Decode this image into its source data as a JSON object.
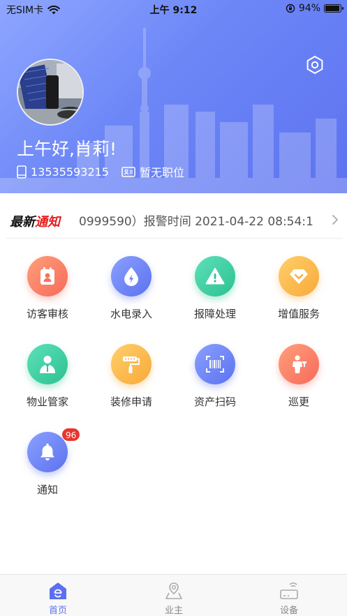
{
  "status_bar": {
    "carrier": "无SIM卡",
    "time": "上午 9:12",
    "battery": "94%",
    "battery_level": 0.94
  },
  "profile": {
    "greeting": "上午好,肖莉!",
    "phone": "13535593215",
    "position": "暂无职位"
  },
  "notice": {
    "title_black": "最新",
    "title_red": "通知",
    "text": "0999590）报警时间 2021-04-22 08:54:1"
  },
  "grid": [
    {
      "label": "访客审核",
      "icon": "visitor-icon",
      "color": "coral"
    },
    {
      "label": "水电录入",
      "icon": "water-electric-icon",
      "color": "blue"
    },
    {
      "label": "报障处理",
      "icon": "warning-icon",
      "color": "green"
    },
    {
      "label": "增值服务",
      "icon": "diamond-icon",
      "color": "yellow"
    },
    {
      "label": "物业管家",
      "icon": "butler-icon",
      "color": "green"
    },
    {
      "label": "装修申请",
      "icon": "paint-roller-icon",
      "color": "yellow"
    },
    {
      "label": "资产扫码",
      "icon": "barcode-scan-icon",
      "color": "blue"
    },
    {
      "label": "巡更",
      "icon": "patrol-icon",
      "color": "coral"
    },
    {
      "label": "通知",
      "icon": "bell-icon",
      "color": "blue",
      "badge": "96"
    }
  ],
  "tabbar": [
    {
      "label": "首页",
      "active": true
    },
    {
      "label": "业主",
      "active": false
    },
    {
      "label": "设备",
      "active": false
    }
  ],
  "colors": {
    "accent": "#5b6ff0",
    "badge": "#e8352e"
  }
}
